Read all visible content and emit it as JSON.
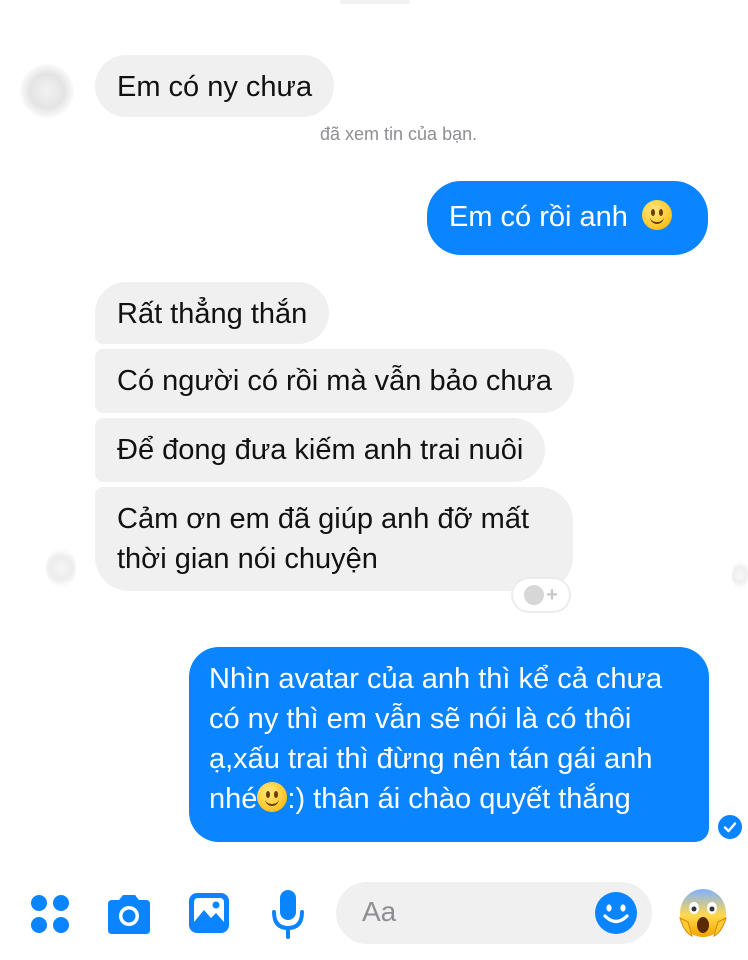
{
  "conversation": {
    "seen_text": "đã xem tin của bạn.",
    "messages": [
      {
        "sender": "other",
        "text": "Em có ny chưa"
      },
      {
        "sender": "me",
        "text": "Em có rồi anh",
        "emoji": "slightly-smiling-face"
      },
      {
        "sender": "other",
        "text": "Rất thẳng thắn"
      },
      {
        "sender": "other",
        "text": "Có người có rồi mà vẫn bảo chưa"
      },
      {
        "sender": "other",
        "text": "Để đong đưa kiếm anh trai nuôi"
      },
      {
        "sender": "other",
        "lines": [
          "Cảm ơn em đã giúp anh đỡ mất",
          "thời gian nói chuyện"
        ]
      },
      {
        "sender": "me",
        "lines": [
          "Nhìn avatar của anh thì kể cả chưa",
          "có ny thì em vẫn sẽ nói là có thôi",
          "ạ,xấu trai thì đừng nên tán gái anh",
          "thân ái chào quyết thắng"
        ],
        "emoji_text_prefix": "nhé",
        "emoji_text_suffix": ":)",
        "emoji": "slightly-smiling-face"
      }
    ],
    "reaction_button": "+",
    "delivery_status": "delivered-check-icon"
  },
  "composer": {
    "placeholder": "Aa",
    "icons": [
      "apps-icon",
      "camera-icon",
      "gallery-icon",
      "microphone-icon",
      "emoji-icon",
      "screaming-face-icon"
    ]
  },
  "colors": {
    "accent": "#0a84ff",
    "incoming_bubble": "#f1f0f0",
    "seen_text": "#8e8e93"
  }
}
